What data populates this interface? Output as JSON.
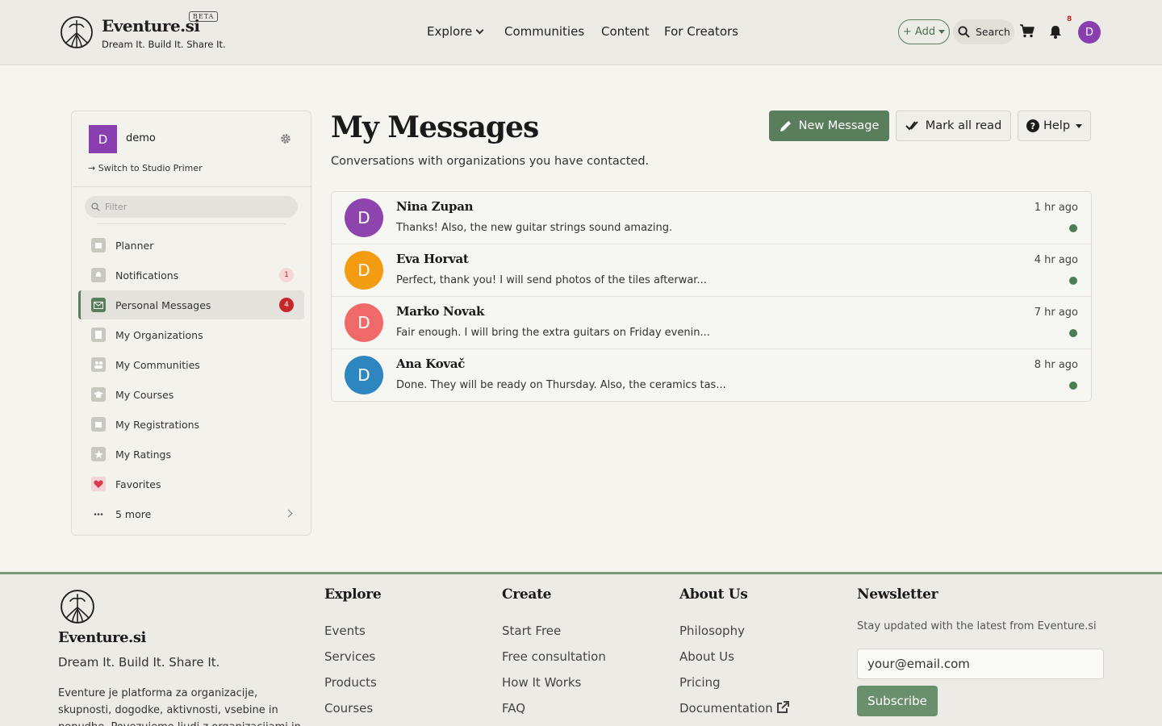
{
  "header": {
    "brand": "Eventure.si",
    "beta": "BETA",
    "tagline": "Dream It. Build It. Share It.",
    "nav": {
      "explore": "Explore",
      "communities": "Communities",
      "content": "Content",
      "creators": "For Creators"
    },
    "add_label": "+ Add",
    "search_label": "Search",
    "notification_count": "8",
    "avatar_letter": "D"
  },
  "sidebar": {
    "avatar_letter": "D",
    "username": "demo",
    "switch_label": "Switch to Studio Primer",
    "filter_placeholder": "Filter",
    "items": [
      {
        "label": "Planner",
        "icon": "calendar-icon"
      },
      {
        "label": "Notifications",
        "icon": "bell-icon",
        "badge": "1"
      },
      {
        "label": "Personal Messages",
        "icon": "envelope-icon",
        "badge": "4"
      },
      {
        "label": "My Organizations",
        "icon": "building-icon"
      },
      {
        "label": "My Communities",
        "icon": "users-icon"
      },
      {
        "label": "My Courses",
        "icon": "graduation-cap-icon"
      },
      {
        "label": "My Registrations",
        "icon": "calendar-check-icon"
      },
      {
        "label": "My Ratings",
        "icon": "star-icon"
      },
      {
        "label": "Favorites",
        "icon": "heart-icon"
      },
      {
        "label": "5 more",
        "icon": "ellipsis-icon"
      }
    ]
  },
  "main": {
    "title": "My Messages",
    "subtitle": "Conversations with organizations you have contacted.",
    "new_message": "New Message",
    "mark_all_read": "Mark all read",
    "help": "Help",
    "messages": [
      {
        "name": "Nina Zupan",
        "preview": "Thanks! Also, the new guitar strings sound amazing.",
        "time": "1 hr ago",
        "letter": "D",
        "color": "#8e44ad"
      },
      {
        "name": "Eva Horvat",
        "preview": "Perfect, thank you! I will send photos of the tiles afterwar...",
        "time": "4 hr ago",
        "letter": "D",
        "color": "#f39c12"
      },
      {
        "name": "Marko Novak",
        "preview": "Fair enough. I will bring the extra guitars on Friday evenin...",
        "time": "7 hr ago",
        "letter": "D",
        "color": "#f06a6a"
      },
      {
        "name": "Ana Kovač",
        "preview": "Done. They will be ready on Thursday. Also, the ceramics tas...",
        "time": "8 hr ago",
        "letter": "D",
        "color": "#2e86c1"
      }
    ]
  },
  "footer": {
    "brand": "Eventure.si",
    "tagline": "Dream It. Build It. Share It.",
    "description": "Eventure je platforma za organizacije, skupnosti, dogodke, aktivnosti, vsebine in ponudbe. Povezujemo ljudi z organizacijami in",
    "explore": {
      "title": "Explore",
      "links": [
        "Events",
        "Services",
        "Products",
        "Courses"
      ]
    },
    "create": {
      "title": "Create",
      "links": [
        "Start Free",
        "Free consultation",
        "How It Works",
        "FAQ"
      ]
    },
    "about": {
      "title": "About Us",
      "links": [
        "Philosophy",
        "About Us",
        "Pricing",
        "Documentation"
      ]
    },
    "newsletter": {
      "title": "Newsletter",
      "text": "Stay updated with the latest from Eventure.si",
      "email_value": "your@email.com",
      "subscribe": "Subscribe"
    }
  },
  "colors": {
    "accent": "#5a7d5c",
    "badge": "#c62828",
    "avatar": "#8a3fb0",
    "unread_dot": "#4a7d52"
  }
}
